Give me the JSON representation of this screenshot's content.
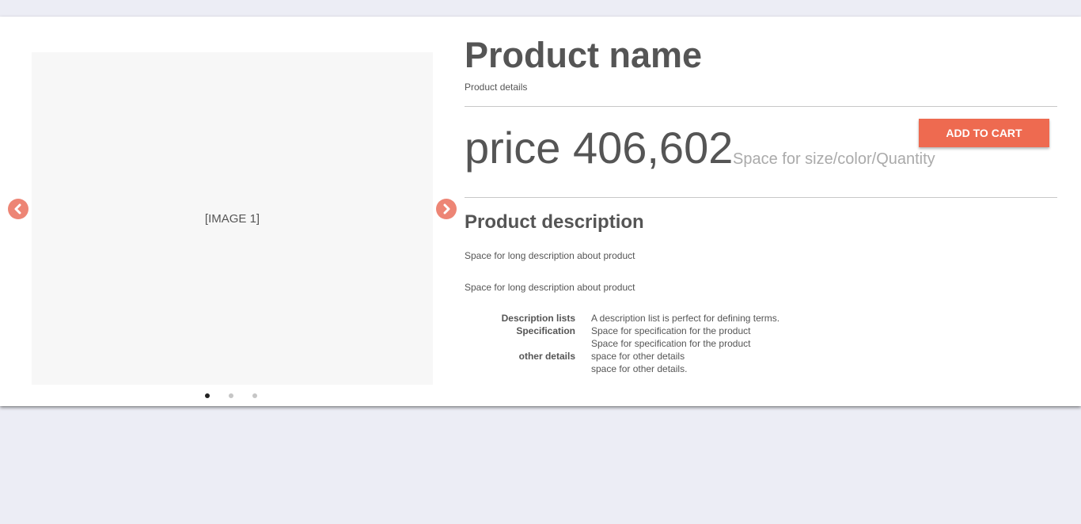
{
  "carousel": {
    "image_placeholder": "[IMAGE 1]",
    "slides": [
      {
        "active": true
      },
      {
        "active": false
      },
      {
        "active": false
      }
    ],
    "prev_icon": "chevron-left-icon",
    "next_icon": "chevron-right-icon"
  },
  "product": {
    "name": "Product name",
    "details": "Product details",
    "price": "price 406,602",
    "variant_note": "Space for size/color/Quantity",
    "add_to_cart_label": "ADD TO CART"
  },
  "description": {
    "title": "Product description",
    "paragraphs": [
      "Space for long description about product",
      "Space for long description about product"
    ],
    "list": [
      {
        "term": "Description lists",
        "def": "A description list is perfect for defining terms."
      },
      {
        "term": "Specification",
        "def": "Space for specification for the product"
      },
      {
        "term": "",
        "def": "Space for specification for the product"
      },
      {
        "term": "other details",
        "def": "space for other details"
      },
      {
        "term": "",
        "def": "space for other details."
      }
    ]
  },
  "colors": {
    "accent": "#ee6a50",
    "arrow": "#ed8575",
    "page_background": "#ecedf5"
  }
}
